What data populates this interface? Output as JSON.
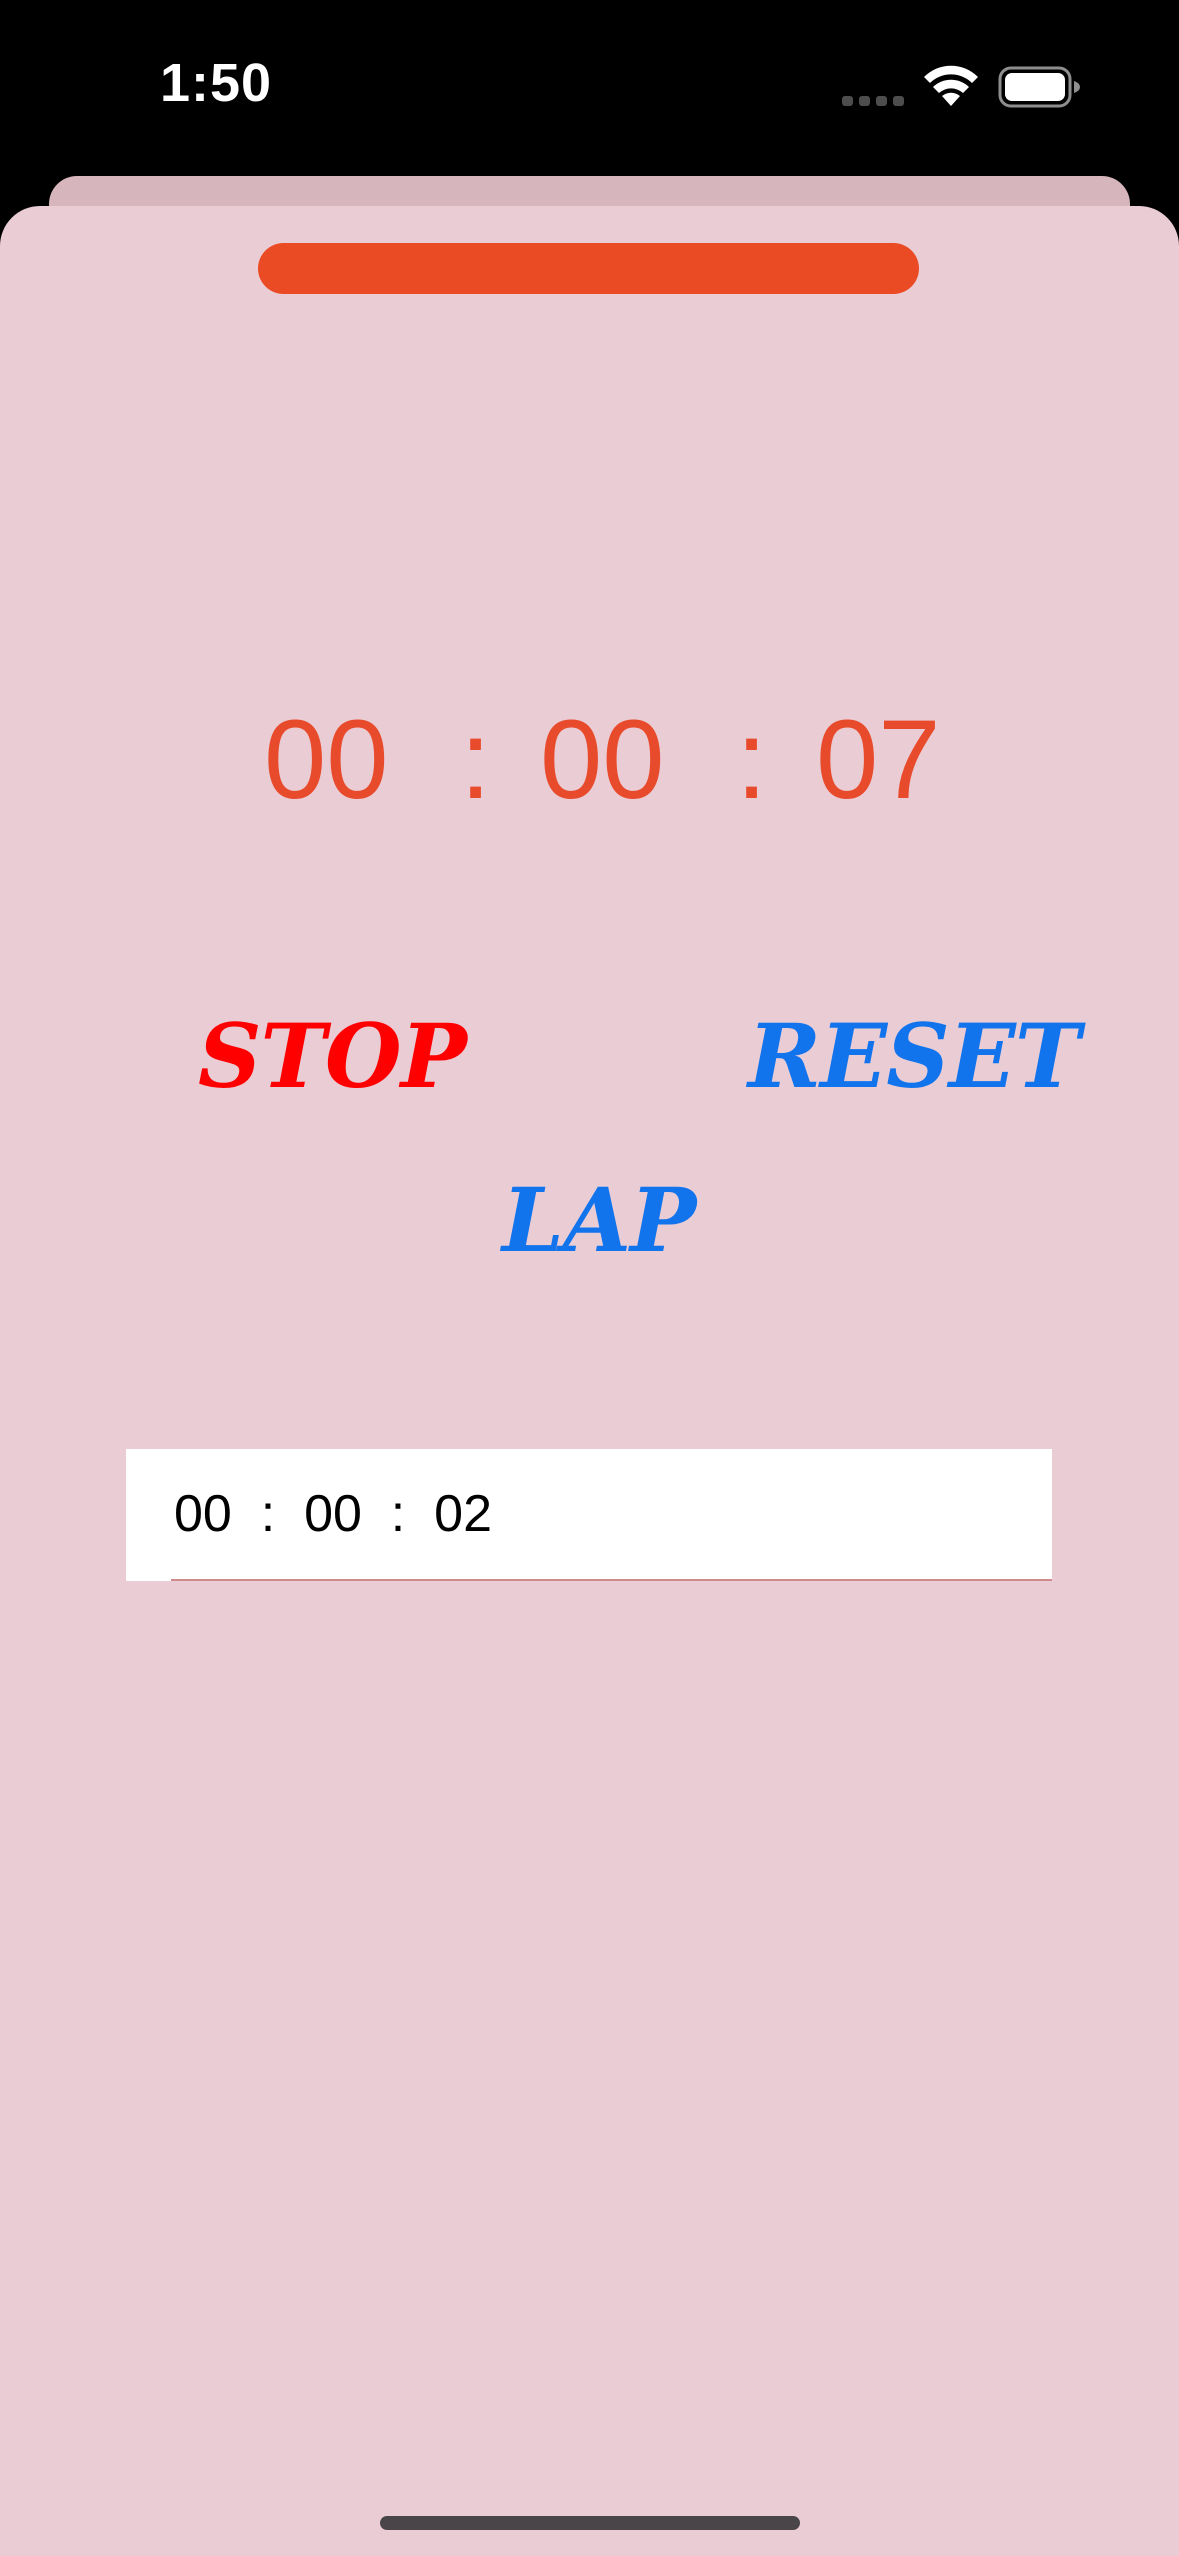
{
  "status_bar": {
    "time": "1:50"
  },
  "colors": {
    "sheet_background": "#eaccd5",
    "accent": "#ea4b25",
    "stop": "#fe0000",
    "reset": "#1274ec",
    "lap": "#1274ec"
  },
  "stopwatch": {
    "hours": "00",
    "minutes": "00",
    "seconds": "07",
    "separator": ":"
  },
  "buttons": {
    "stop_label": "STOP",
    "reset_label": "RESET",
    "lap_label": "LAP"
  },
  "laps": [
    {
      "time": "00  :  00  :  02"
    }
  ],
  "icons": {
    "signal": "cellular-signal-icon",
    "wifi": "wifi-icon",
    "battery": "battery-icon"
  }
}
